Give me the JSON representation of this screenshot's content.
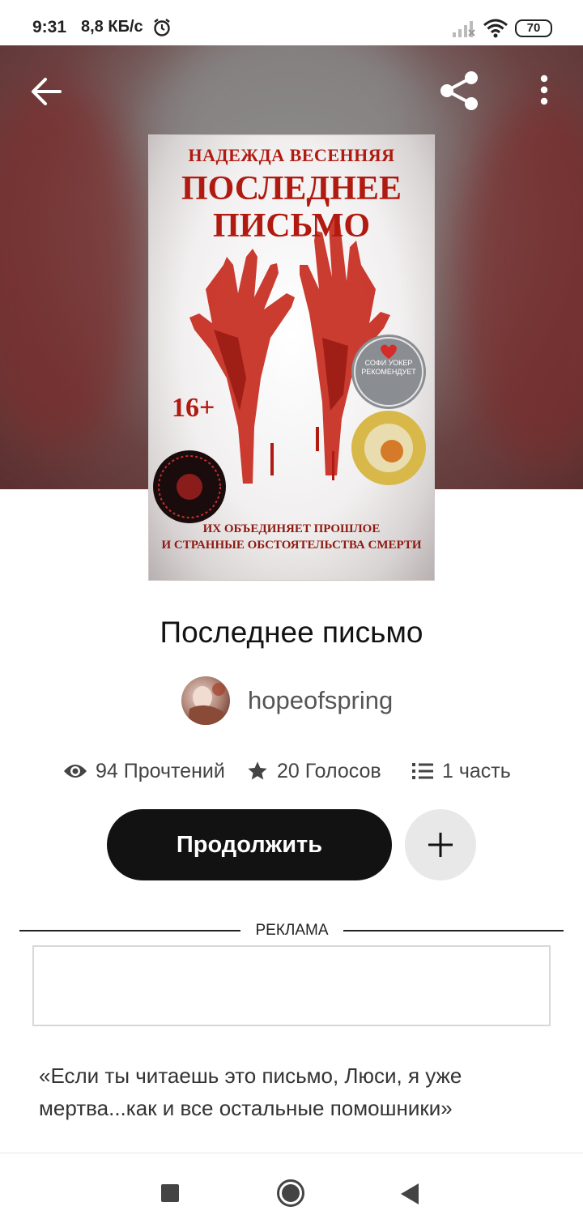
{
  "status_bar": {
    "time": "9:31",
    "net_speed": "8,8 КБ/с",
    "battery": "70",
    "icons": [
      "alarm-icon",
      "signal-icon",
      "wifi-icon",
      "battery-icon"
    ]
  },
  "hero": {
    "back_icon": "arrow-left-icon",
    "share_icon": "share-icon",
    "more_icon": "more-vertical-icon"
  },
  "cover": {
    "author": "НАДЕЖДА ВЕСЕННЯЯ",
    "title_line1": "ПОСЛЕДНЕЕ",
    "title_line2": "ПИСЬМО",
    "age_rating": "16+",
    "badge_text": "СОФИ УОКЕР РЕКОМЕНДУЕТ",
    "tagline_line1": "ИХ ОБЪЕДИНЯЕТ ПРОШЛОЕ",
    "tagline_line2": "И СТРАННЫЕ ОБСТОЯТЕЛЬСТВА СМЕРТИ"
  },
  "book": {
    "title": "Последнее письмо",
    "author": "hopeofspring",
    "stats": {
      "reads": "94 Прочтений",
      "votes": "20 Голосов",
      "parts": "1 часть"
    },
    "continue_label": "Продолжить",
    "add_icon": "plus-icon",
    "description": "«Если ты читаешь это письмо, Люси, я уже мертва...как и все остальные помошники»"
  },
  "ad": {
    "label": "РЕКЛАМА"
  },
  "nav_bar": {
    "icons": [
      "recents-square-icon",
      "home-circle-icon",
      "back-triangle-icon"
    ]
  },
  "colors": {
    "accent_dark": "#121212",
    "cover_red": "#b01a10",
    "add_button_bg": "#e8e8e8"
  }
}
